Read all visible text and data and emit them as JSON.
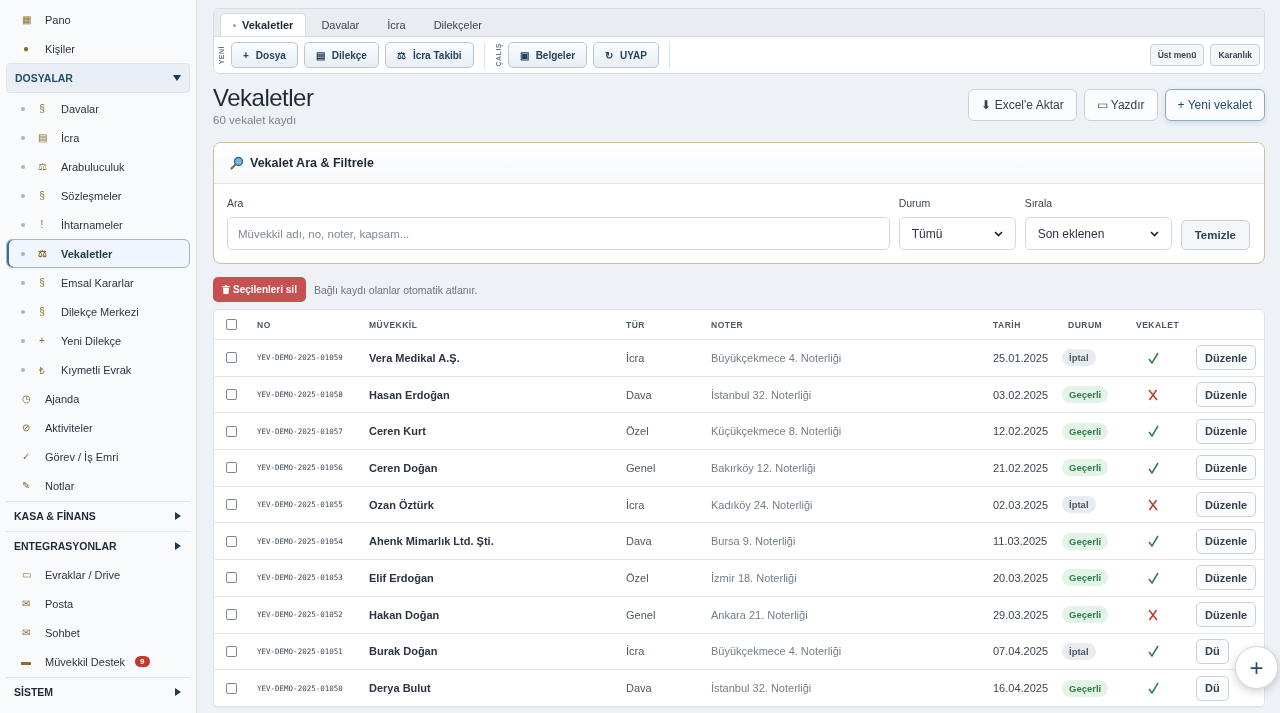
{
  "sidebar": {
    "items": [
      {
        "kind": "link",
        "icon": "▦",
        "label": "Pano",
        "selected": false
      },
      {
        "kind": "link",
        "icon": "●",
        "label": "Kişiler",
        "selected": false
      },
      {
        "kind": "group",
        "label": "DOSYALAR",
        "expanded": true,
        "children": [
          {
            "icon": "§",
            "label": "Davalar",
            "selected": false
          },
          {
            "icon": "▤",
            "label": "İcra",
            "selected": false
          },
          {
            "icon": "⚖",
            "label": "Arabuluculuk",
            "selected": false
          },
          {
            "icon": "§",
            "label": "Sözleşmeler",
            "selected": false
          },
          {
            "icon": "!",
            "label": "İhtarnameler",
            "selected": false
          },
          {
            "icon": "⚖",
            "label": "Vekaletler",
            "selected": true
          },
          {
            "icon": "§",
            "label": "Emsal Kararlar",
            "selected": false
          },
          {
            "icon": "§",
            "label": "Dilekçe Merkezi",
            "selected": false
          },
          {
            "icon": "+",
            "label": "Yeni Dilekçe",
            "selected": false
          },
          {
            "icon": "₺",
            "label": "Kıymetli Evrak",
            "selected": false
          }
        ]
      },
      {
        "kind": "link",
        "icon": "◷",
        "label": "Ajanda",
        "selected": false
      },
      {
        "kind": "link",
        "icon": "⊘",
        "label": "Aktiviteler",
        "selected": false
      },
      {
        "kind": "link",
        "icon": "✓",
        "label": "Görev / İş Emri",
        "selected": false
      },
      {
        "kind": "link",
        "icon": "✎",
        "label": "Notlar",
        "selected": false
      },
      {
        "kind": "group",
        "label": "KASA & FİNANS",
        "expanded": false
      },
      {
        "kind": "group",
        "label": "ENTEGRASYONLAR",
        "expanded": false
      },
      {
        "kind": "link",
        "icon": "▭",
        "label": "Evraklar / Drive",
        "selected": false
      },
      {
        "kind": "link",
        "icon": "✉",
        "label": "Posta",
        "selected": false
      },
      {
        "kind": "link",
        "icon": "✉",
        "label": "Sohbet",
        "selected": false
      },
      {
        "kind": "link",
        "icon": "▬",
        "label": "Müvekkil Destek",
        "selected": false,
        "badge": "9"
      },
      {
        "kind": "group",
        "label": "SİSTEM",
        "expanded": false
      }
    ]
  },
  "tabs": [
    {
      "label": "Vekaletler",
      "selected": true
    },
    {
      "label": "Davalar",
      "selected": false
    },
    {
      "label": "İcra",
      "selected": false
    },
    {
      "label": "Dilekçeler",
      "selected": false
    }
  ],
  "toolbar": {
    "groups": [
      {
        "label": "YENİ",
        "buttons": [
          {
            "icon": "+",
            "label": "Dosya"
          },
          {
            "icon": "▤",
            "label": "Dilekçe"
          },
          {
            "icon": "⚖",
            "label": "İcra Takibi"
          }
        ]
      },
      {
        "label": "ÇALIŞ",
        "buttons": [
          {
            "icon": "▣",
            "label": "Belgeler"
          },
          {
            "icon": "↻",
            "label": "UYAP"
          }
        ]
      }
    ],
    "right_buttons": [
      "Üst menü",
      "Karanlık"
    ]
  },
  "page": {
    "title": "Vekaletler",
    "subtitle": "60 vekalet kaydı",
    "actions": [
      "⬇ Excel'e Aktar",
      "▭ Yazdır",
      "+ Yeni vekalet"
    ]
  },
  "filter": {
    "title": "Vekalet Ara & Filtrele",
    "search_label": "Ara",
    "search_placeholder": "Müvekkil adı, no, noter, kapsam...",
    "status_label": "Durum",
    "status_value": "Tümü",
    "sort_label": "Sırala",
    "sort_value": "Son eklenen",
    "clear": "Temizle"
  },
  "bulk": {
    "delete": "Seçilenleri sil",
    "note": "Bağlı kaydı olanlar otomatik atlanır."
  },
  "table": {
    "select_all": {
      "checked": false
    },
    "columns": [
      "NO",
      "MÜVEKKİL",
      "TÜR",
      "NOTER",
      "TARİH",
      "DURUM",
      "VEKALET"
    ],
    "rows": [
      {
        "checked": false,
        "no": "YEV-DEMO-2025-01059",
        "client": "Vera Medikal A.Ş.",
        "type": "İcra",
        "notary": "Büyükçekmece 4. Noterliği",
        "date": "25.01.2025",
        "status": "İptal",
        "valid": false,
        "vekalet": true,
        "action": "Düzenle"
      },
      {
        "checked": false,
        "no": "YEV-DEMO-2025-01058",
        "client": "Hasan Erdoğan",
        "type": "Dava",
        "notary": "İstanbul 32. Noterliği",
        "date": "03.02.2025",
        "status": "Geçerli",
        "valid": true,
        "vekalet": false,
        "action": "Düzenle"
      },
      {
        "checked": false,
        "no": "YEV-DEMO-2025-01057",
        "client": "Ceren Kurt",
        "type": "Özel",
        "notary": "Küçükçekmece 8. Noterliği",
        "date": "12.02.2025",
        "status": "Geçerli",
        "valid": true,
        "vekalet": true,
        "action": "Düzenle"
      },
      {
        "checked": false,
        "no": "YEV-DEMO-2025-01056",
        "client": "Ceren Doğan",
        "type": "Genel",
        "notary": "Bakırköy 12. Noterliği",
        "date": "21.02.2025",
        "status": "Geçerli",
        "valid": true,
        "vekalet": true,
        "action": "Düzenle"
      },
      {
        "checked": false,
        "no": "YEV-DEMO-2025-01055",
        "client": "Ozan Öztürk",
        "type": "İcra",
        "notary": "Kadıköy 24. Noterliği",
        "date": "02.03.2025",
        "status": "İptal",
        "valid": false,
        "vekalet": false,
        "action": "Düzenle"
      },
      {
        "checked": false,
        "no": "YEV-DEMO-2025-01054",
        "client": "Ahenk Mimarlık Ltd. Şti.",
        "type": "Dava",
        "notary": "Bursa 9. Noterliği",
        "date": "11.03.2025",
        "status": "Geçerli",
        "valid": true,
        "vekalet": true,
        "action": "Düzenle"
      },
      {
        "checked": false,
        "no": "YEV-DEMO-2025-01053",
        "client": "Elif Erdoğan",
        "type": "Özel",
        "notary": "İzmir 18. Noterliği",
        "date": "20.03.2025",
        "status": "Geçerli",
        "valid": true,
        "vekalet": true,
        "action": "Düzenle"
      },
      {
        "checked": false,
        "no": "YEV-DEMO-2025-01052",
        "client": "Hakan Doğan",
        "type": "Genel",
        "notary": "Ankara 21. Noterliği",
        "date": "29.03.2025",
        "status": "Geçerli",
        "valid": true,
        "vekalet": false,
        "action": "Düzenle"
      },
      {
        "checked": false,
        "no": "YEV-DEMO-2025-01051",
        "client": "Burak Doğan",
        "type": "İcra",
        "notary": "Büyükçekmece 4. Noterliği",
        "date": "07.04.2025",
        "status": "İptal",
        "valid": false,
        "vekalet": true,
        "action": "Dü"
      },
      {
        "checked": false,
        "no": "YEV-DEMO-2025-01050",
        "client": "Derya Bulut",
        "type": "Dava",
        "notary": "İstanbul 32. Noterliği",
        "date": "16.04.2025",
        "status": "Geçerli",
        "valid": true,
        "vekalet": true,
        "action": "Dü"
      }
    ]
  },
  "fab": {
    "icon": "+"
  }
}
